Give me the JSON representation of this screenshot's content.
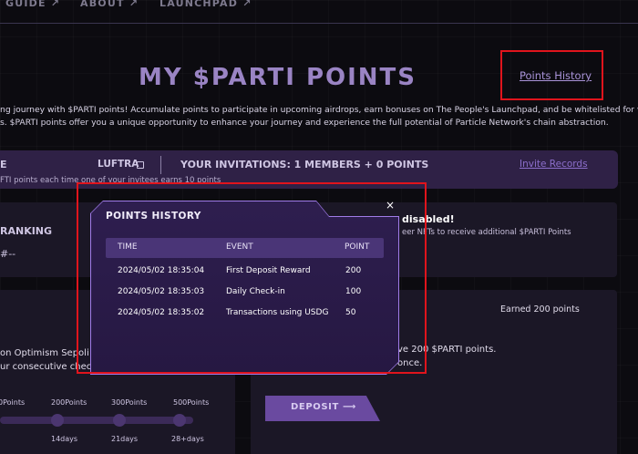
{
  "nav": {
    "items": [
      "GUIDE",
      "ABOUT",
      "LAUNCHPAD"
    ]
  },
  "hero": {
    "title": "MY $PARTI POINTS",
    "history_link": "Points History",
    "intro_line1": "ng journey with $PARTI points! Accumulate points to participate in upcoming airdrops, earn bonuses on The People's Launchpad, and be whitelisted for various",
    "intro_line2": "s. $PARTI points offer you a unique opportunity to enhance your journey and experience the full potential of Particle Network's chain abstraction."
  },
  "invite": {
    "label_fragment": "E",
    "code": "LUFTRA",
    "invitations": "YOUR INVITATIONS: 1 MEMBERS   + 0 POINTS",
    "records_link": "Invite Records",
    "subtext": "FTI points each time one of your invitees earns 10 points"
  },
  "ranking": {
    "title": "RANKING",
    "value": "#--"
  },
  "nft": {
    "title": "disabled!",
    "subtitle": "eer NFTs to receive additional $PARTI Points"
  },
  "deposit": {
    "earned": "Earned 200 points",
    "receive": "ve 200 $PARTI points.",
    "once": "once.",
    "button_label": "DEPOSIT ⟶"
  },
  "checkin": {
    "line1": "on Optimism Sepoli",
    "line2": "ur consecutive check-i",
    "milestones": [
      {
        "points": "0Points",
        "days": ""
      },
      {
        "points": "200Points",
        "days": "14days"
      },
      {
        "points": "300Points",
        "days": "21days"
      },
      {
        "points": "500Points",
        "days": "28+days"
      }
    ]
  },
  "modal": {
    "title": "POINTS HISTORY",
    "close": "×",
    "columns": [
      "TIME",
      "EVENT",
      "POINT"
    ],
    "rows": [
      {
        "time": "2024/05/02 18:35:04",
        "event": "First Deposit Reward",
        "point": "200"
      },
      {
        "time": "2024/05/02 18:35:03",
        "event": "Daily Check-in",
        "point": "100"
      },
      {
        "time": "2024/05/02 18:35:02",
        "event": "Transactions using USDG",
        "point": "50"
      }
    ]
  }
}
